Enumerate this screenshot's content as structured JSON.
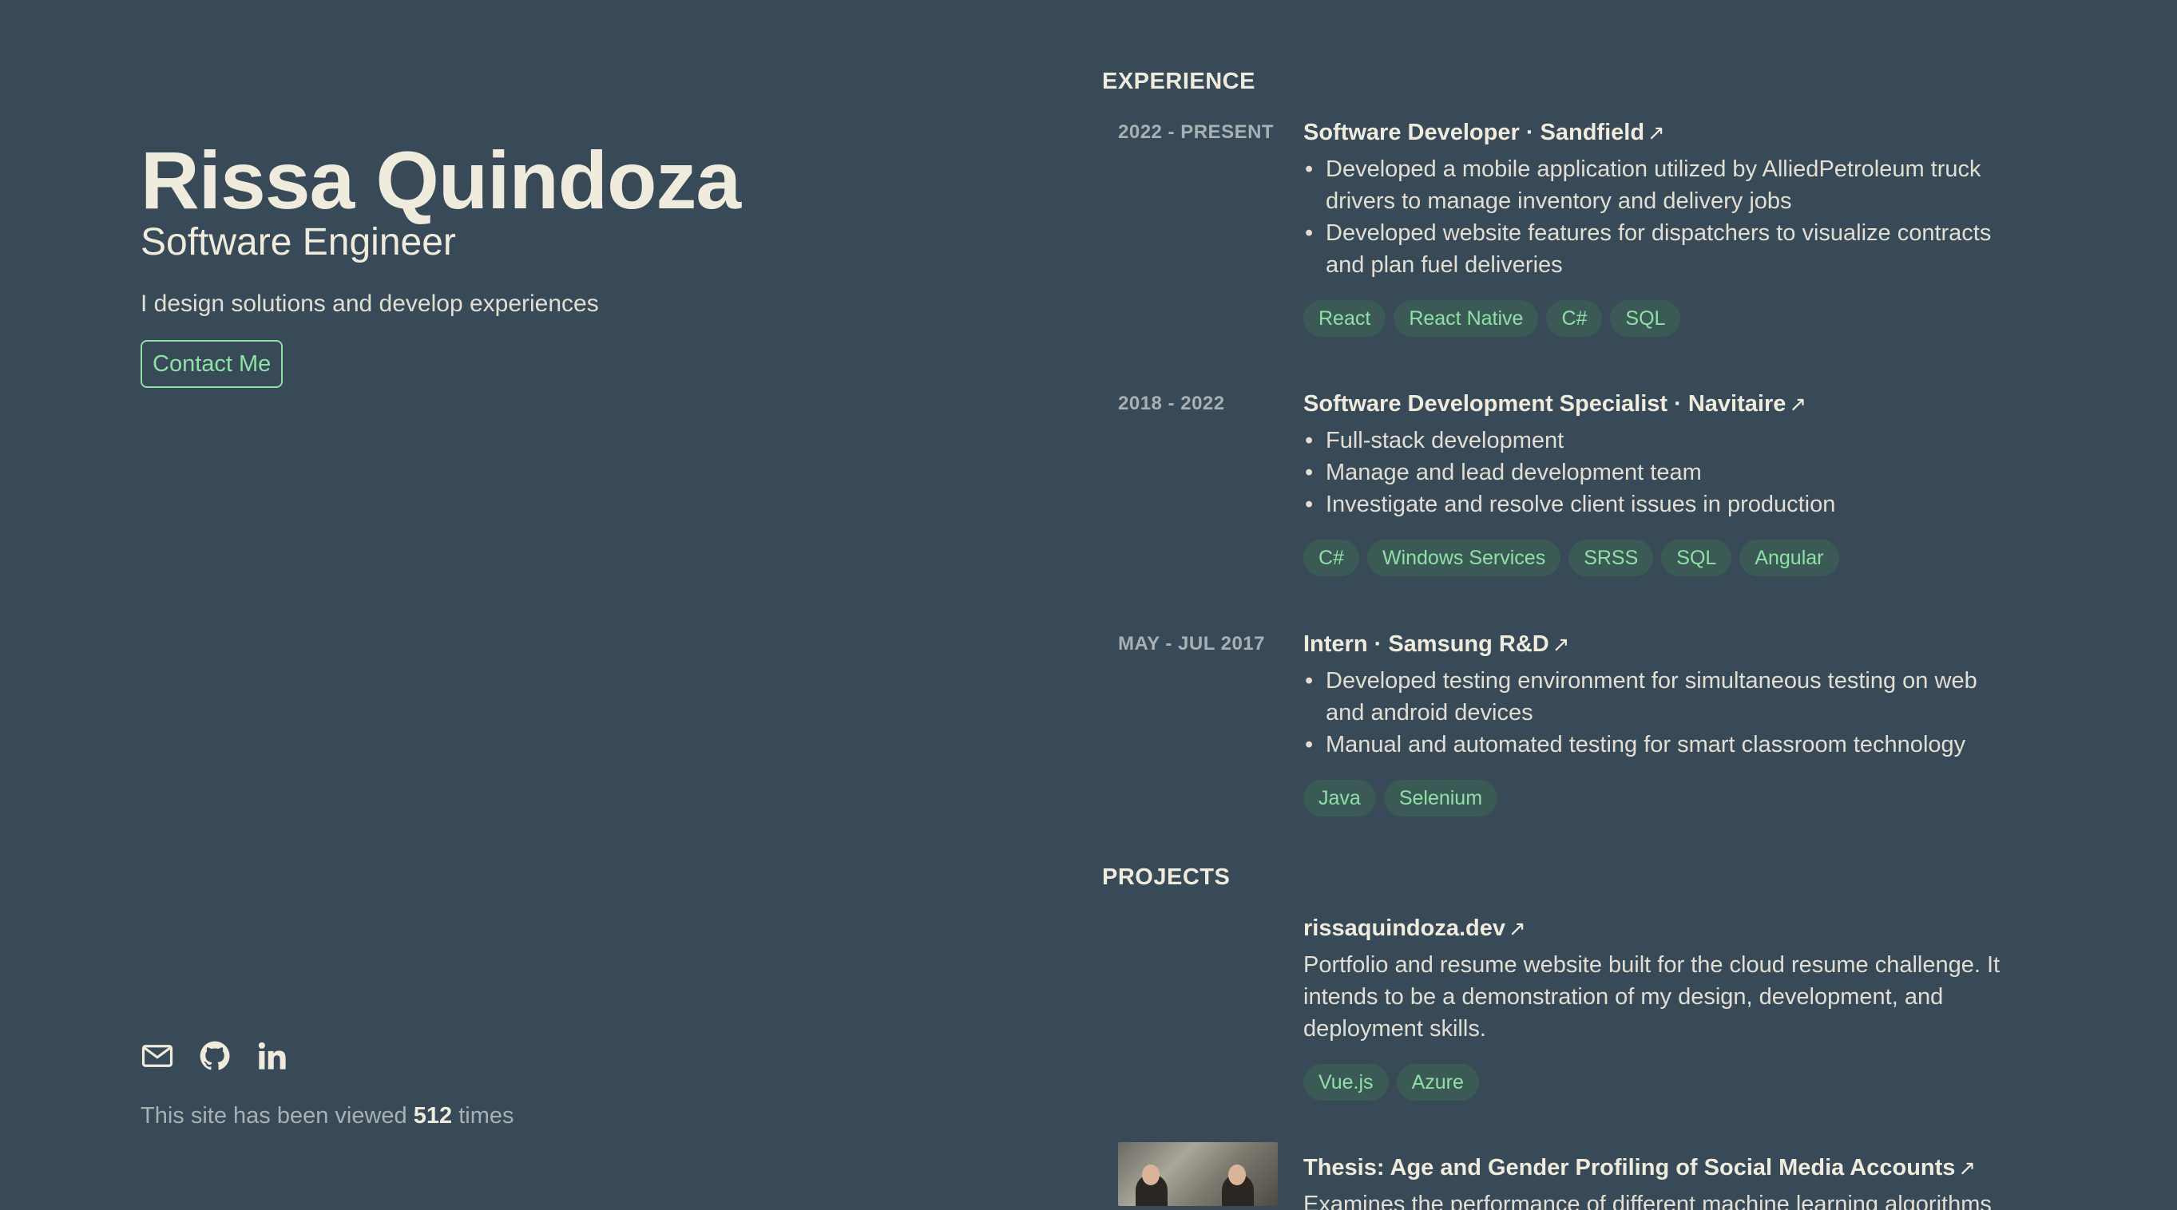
{
  "profile": {
    "name": "Rissa Quindoza",
    "role": "Software Engineer",
    "tagline": "I design solutions and develop experiences",
    "contact_label": "Contact Me"
  },
  "socials": [
    "mail-icon",
    "github-icon",
    "linkedin-icon"
  ],
  "views": {
    "prefix": "This site has been viewed",
    "count": "512",
    "suffix": "times"
  },
  "experience": {
    "title": "EXPERIENCE",
    "items": [
      {
        "date": "2022 - PRESENT",
        "title": "Software Developer · Sandfield",
        "bullets": [
          "Developed a mobile application utilized by AlliedPetroleum truck drivers to manage inventory and delivery jobs",
          "Developed website features for dispatchers to visualize contracts and plan fuel deliveries"
        ],
        "tags": [
          "React",
          "React Native",
          "C#",
          "SQL"
        ]
      },
      {
        "date": "2018 - 2022",
        "title": "Software Development Specialist · Navitaire",
        "bullets": [
          "Full-stack development",
          "Manage and lead development team",
          "Investigate and resolve client issues in production"
        ],
        "tags": [
          "C#",
          "Windows Services",
          "SRSS",
          "SQL",
          "Angular"
        ]
      },
      {
        "date": "MAY - JUL 2017",
        "title": "Intern · Samsung R&D",
        "bullets": [
          "Developed testing environment for simultaneous testing on web and android devices",
          "Manual and automated testing for smart classroom technology"
        ],
        "tags": [
          "Java",
          "Selenium"
        ]
      }
    ]
  },
  "projects": {
    "title": "PROJECTS",
    "items": [
      {
        "title": "rissaquindoza.dev",
        "description": "Portfolio and resume website built for the cloud resume challenge. It intends to be a demonstration of my design, development, and deployment skills.",
        "tags": [
          "Vue.js",
          "Azure"
        ]
      },
      {
        "title": "Thesis: Age and Gender Profiling of Social Media Accounts",
        "description": "Examines the performance of different machine learning algorithms"
      }
    ]
  },
  "icons": {
    "external_link": "↗",
    "bullet": "•"
  },
  "colors": {
    "background": "#384958",
    "accent": "#8fe0a6",
    "text": "#efebdd",
    "muted": "#a8b0b4",
    "tag_bg": "#3c5a55"
  }
}
